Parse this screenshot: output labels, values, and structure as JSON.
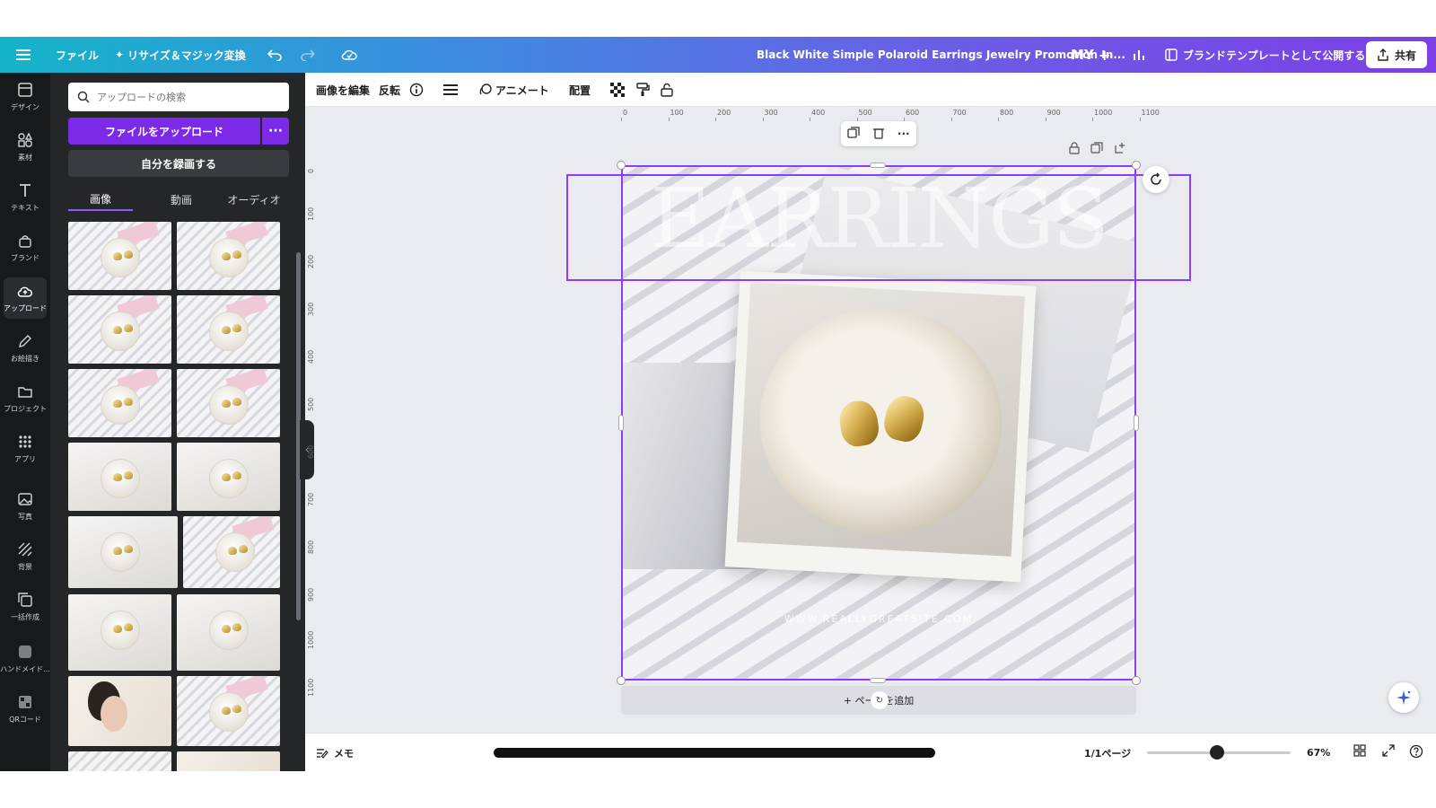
{
  "topbar": {
    "file_label": "ファイル",
    "resize_label": "リサイズ＆マジック変換",
    "doc_title": "Black White Simple Polaroid Earrings Jewelry Promotion In...",
    "avatar_initials": "MY",
    "brand_template_label": "ブランドテンプレートとして公開する",
    "share_label": "共有"
  },
  "rail": {
    "items": [
      {
        "label": "デザイン",
        "icon": "layout-icon"
      },
      {
        "label": "素材",
        "icon": "shapes-icon"
      },
      {
        "label": "テキスト",
        "icon": "text-icon"
      },
      {
        "label": "ブランド",
        "icon": "brand-icon"
      },
      {
        "label": "アップロード",
        "icon": "cloud-upload-icon"
      },
      {
        "label": "お絵描き",
        "icon": "draw-icon"
      },
      {
        "label": "プロジェクト",
        "icon": "folder-icon"
      },
      {
        "label": "アプリ",
        "icon": "apps-icon"
      },
      {
        "label": "写真",
        "icon": "photo-icon"
      },
      {
        "label": "背景",
        "icon": "background-icon"
      },
      {
        "label": "一括作成",
        "icon": "bulk-create-icon"
      },
      {
        "label": "ハンドメイド...",
        "icon": "handmade-icon"
      },
      {
        "label": "QRコード",
        "icon": "qr-code-icon"
      }
    ],
    "active_index": 4
  },
  "panel": {
    "search_placeholder": "アップロードの検索",
    "upload_label": "ファイルをアップロード",
    "record_label": "自分を録画する",
    "tabs": [
      "画像",
      "動画",
      "オーディオ"
    ],
    "active_tab": 0
  },
  "toolbar": {
    "edit_image": "画像を編集",
    "flip": "反転",
    "animate": "アニメート",
    "position": "配置"
  },
  "ruler": {
    "top": [
      "0",
      "100",
      "200",
      "300",
      "400",
      "500",
      "600",
      "700",
      "800",
      "900",
      "1000",
      "1100"
    ],
    "left": [
      "0",
      "100",
      "200",
      "300",
      "400",
      "500",
      "600",
      "700",
      "800",
      "900",
      "1000",
      "1100"
    ]
  },
  "canvas": {
    "headline": "EARRINGS",
    "website": "WWW.REALLYGREATSITE.COM",
    "add_page_label": "+ ページを追加"
  },
  "bottombar": {
    "memo_label": "メモ",
    "page_count": "1/1ページ",
    "zoom_percent": 67,
    "zoom_label": "67%"
  },
  "colors": {
    "accent": "#7d2ae8",
    "selection": "#8b3dff",
    "rail_bg": "#18191b",
    "panel_bg": "#252628"
  }
}
